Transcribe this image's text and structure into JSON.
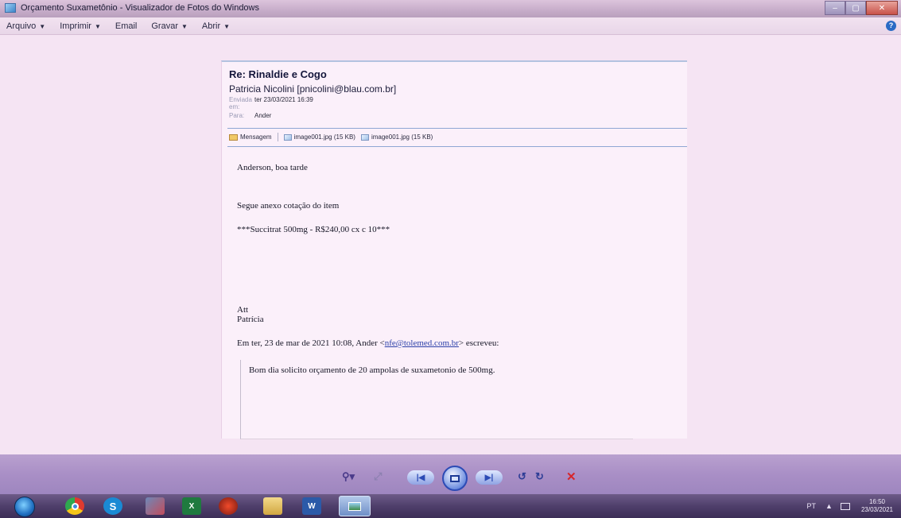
{
  "window": {
    "title": "Orçamento Suxametônio - Visualizador de Fotos do Windows",
    "controls": {
      "minimize": "–",
      "maximize": "▢",
      "close": "✕"
    }
  },
  "menu": {
    "items": [
      {
        "label": "Arquivo",
        "has_dropdown": true
      },
      {
        "label": "Imprimir",
        "has_dropdown": true
      },
      {
        "label": "Email",
        "has_dropdown": false
      },
      {
        "label": "Gravar",
        "has_dropdown": true
      },
      {
        "label": "Abrir",
        "has_dropdown": true
      }
    ],
    "dropdown_arrow": "▼",
    "help_icon": "?"
  },
  "email": {
    "subject": "Re: Rinaldie e Cogo",
    "sender": "Patricia Nicolini [pnicolini@blau.com.br]",
    "sent_label": "Enviada em:",
    "sent_value": "ter 23/03/2021 16:39",
    "to_label": "Para:",
    "to_value": "Ander",
    "attachments": [
      {
        "label": "Mensagem",
        "icon": "envelope-icon"
      },
      {
        "label": "image001.jpg (15 KB)",
        "icon": "image-file-icon"
      },
      {
        "label": "image001.jpg (15 KB)",
        "icon": "image-file-icon"
      }
    ],
    "body": {
      "greeting": "Anderson, boa tarde",
      "line1": "Segue anexo cotação do item",
      "line2": "***Succitrat 500mg - R$240,00 cx c 10***",
      "signoff1": "Att",
      "signoff2": "Patrícia",
      "reply_intro_prefix": "Em ter, 23 de mar de 2021 10:08, Ander <",
      "reply_link": "nfe@tolemed.com.br",
      "reply_intro_suffix": "> escreveu:",
      "quoted_text": "Bom dia solicito orçamento de 20 ampolas de suxametonio de 500mg."
    }
  },
  "viewer_controls": {
    "zoom": "⚲▾",
    "fit": "⤢",
    "prev": "|◀",
    "next": "▶|",
    "rotate_left": "↺",
    "rotate_right": "↻",
    "delete": "✕"
  },
  "taskbar": {
    "excel_label": "X",
    "word_label": "W",
    "skype_label": "S",
    "tray_language": "PT",
    "tray_arrow": "▲",
    "clock_time": "16:50",
    "clock_date": "23/03/2021"
  }
}
